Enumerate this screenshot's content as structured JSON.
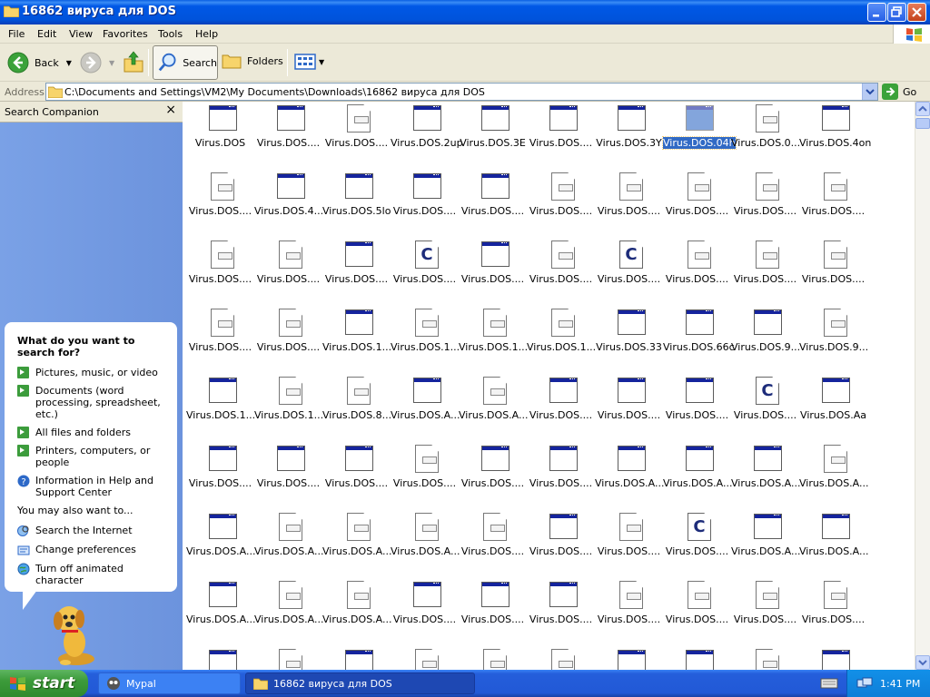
{
  "window": {
    "title": "16862 вируса для DOS"
  },
  "menu": [
    "File",
    "Edit",
    "View",
    "Favorites",
    "Tools",
    "Help"
  ],
  "toolbar": {
    "back": "Back",
    "search": "Search",
    "folders": "Folders"
  },
  "address": {
    "label": "Address",
    "path": "C:\\Documents and Settings\\VM2\\My Documents\\Downloads\\16862 вируса для DOS",
    "go": "Go"
  },
  "companion": {
    "title": "Search Companion",
    "close": "×",
    "question": "What do you want to search for?",
    "options": [
      "Pictures, music, or video",
      "Documents (word processing, spreadsheet, etc.)",
      "All files and folders",
      "Printers, computers, or people",
      "Information in Help and Support Center"
    ],
    "also_label": "You may also want to...",
    "also": [
      "Search the Internet",
      "Change preferences",
      "Turn off animated character"
    ]
  },
  "files": [
    [
      "Virus.DOS",
      "Virus.DOS....",
      "Virus.DOS....",
      "Virus.DOS.2up",
      "Virus.DOS.3E",
      "Virus.DOS....",
      "Virus.DOS.3Y",
      "Virus.DOS.04h",
      "Virus.DOS.0...",
      "Virus.DOS.4on"
    ],
    [
      "Virus.DOS....",
      "Virus.DOS.4...",
      "Virus.DOS.5lo",
      "Virus.DOS....",
      "Virus.DOS....",
      "Virus.DOS....",
      "Virus.DOS....",
      "Virus.DOS....",
      "Virus.DOS....",
      "Virus.DOS...."
    ],
    [
      "Virus.DOS....",
      "Virus.DOS....",
      "Virus.DOS....",
      "Virus.DOS....",
      "Virus.DOS....",
      "Virus.DOS....",
      "Virus.DOS....",
      "Virus.DOS....",
      "Virus.DOS....",
      "Virus.DOS...."
    ],
    [
      "Virus.DOS....",
      "Virus.DOS....",
      "Virus.DOS.1...",
      "Virus.DOS.1...",
      "Virus.DOS.1...",
      "Virus.DOS.1...",
      "Virus.DOS.33",
      "Virus.DOS.66c",
      "Virus.DOS.9...",
      "Virus.DOS.9..."
    ],
    [
      "Virus.DOS.1...",
      "Virus.DOS.1...",
      "Virus.DOS.8...",
      "Virus.DOS.A...",
      "Virus.DOS.A...",
      "Virus.DOS....",
      "Virus.DOS....",
      "Virus.DOS....",
      "Virus.DOS....",
      "Virus.DOS.Aa"
    ],
    [
      "Virus.DOS....",
      "Virus.DOS....",
      "Virus.DOS....",
      "Virus.DOS....",
      "Virus.DOS....",
      "Virus.DOS....",
      "Virus.DOS.A...",
      "Virus.DOS.A...",
      "Virus.DOS.A...",
      "Virus.DOS.A..."
    ],
    [
      "Virus.DOS.A...",
      "Virus.DOS.A...",
      "Virus.DOS.A...",
      "Virus.DOS.A...",
      "Virus.DOS....",
      "Virus.DOS....",
      "Virus.DOS....",
      "Virus.DOS....",
      "Virus.DOS.A...",
      "Virus.DOS.A..."
    ],
    [
      "Virus.DOS.A...",
      "Virus.DOS.A...",
      "Virus.DOS.A...",
      "Virus.DOS....",
      "Virus.DOS....",
      "Virus.DOS....",
      "Virus.DOS....",
      "Virus.DOS....",
      "Virus.DOS....",
      "Virus.DOS...."
    ],
    [
      "",
      "",
      "",
      "",
      "",
      "",
      "",
      "",
      "",
      ""
    ]
  ],
  "icons": [
    [
      "window-icon",
      "window-icon",
      "document-icon",
      "window-icon",
      "window-icon",
      "window-icon",
      "window-icon",
      "window-icon",
      "document-icon",
      "window-icon"
    ],
    [
      "document-icon",
      "window-icon",
      "window-icon",
      "window-icon",
      "window-icon",
      "document-icon",
      "document-icon",
      "document-icon",
      "document-icon",
      "document-icon"
    ],
    [
      "document-icon",
      "document-icon",
      "window-icon",
      "c-file-icon",
      "window-icon",
      "document-icon",
      "c-file-icon",
      "document-icon",
      "document-icon",
      "document-icon"
    ],
    [
      "document-icon",
      "document-icon",
      "window-icon",
      "document-icon",
      "document-icon",
      "document-icon",
      "window-icon",
      "window-icon",
      "window-icon",
      "document-icon"
    ],
    [
      "window-icon",
      "document-icon",
      "document-icon",
      "window-icon",
      "document-icon",
      "window-icon",
      "window-icon",
      "window-icon",
      "c-file-icon",
      "window-icon"
    ],
    [
      "window-icon",
      "window-icon",
      "window-icon",
      "document-icon",
      "window-icon",
      "window-icon",
      "window-icon",
      "window-icon",
      "window-icon",
      "document-icon"
    ],
    [
      "window-icon",
      "document-icon",
      "document-icon",
      "document-icon",
      "document-icon",
      "window-icon",
      "document-icon",
      "c-file-icon",
      "window-icon",
      "window-icon"
    ],
    [
      "window-icon",
      "document-icon",
      "document-icon",
      "window-icon",
      "window-icon",
      "window-icon",
      "document-icon",
      "document-icon",
      "document-icon",
      "document-icon"
    ],
    [
      "window-icon",
      "document-icon",
      "window-icon",
      "document-icon",
      "document-icon",
      "document-icon",
      "window-icon",
      "window-icon",
      "document-icon",
      "window-icon"
    ]
  ],
  "selected": "Virus.DOS.04h",
  "taskbar": {
    "start": "start",
    "tasks": [
      "Mypal",
      "16862 вируса для DOS"
    ],
    "clock": "1:41 PM"
  }
}
